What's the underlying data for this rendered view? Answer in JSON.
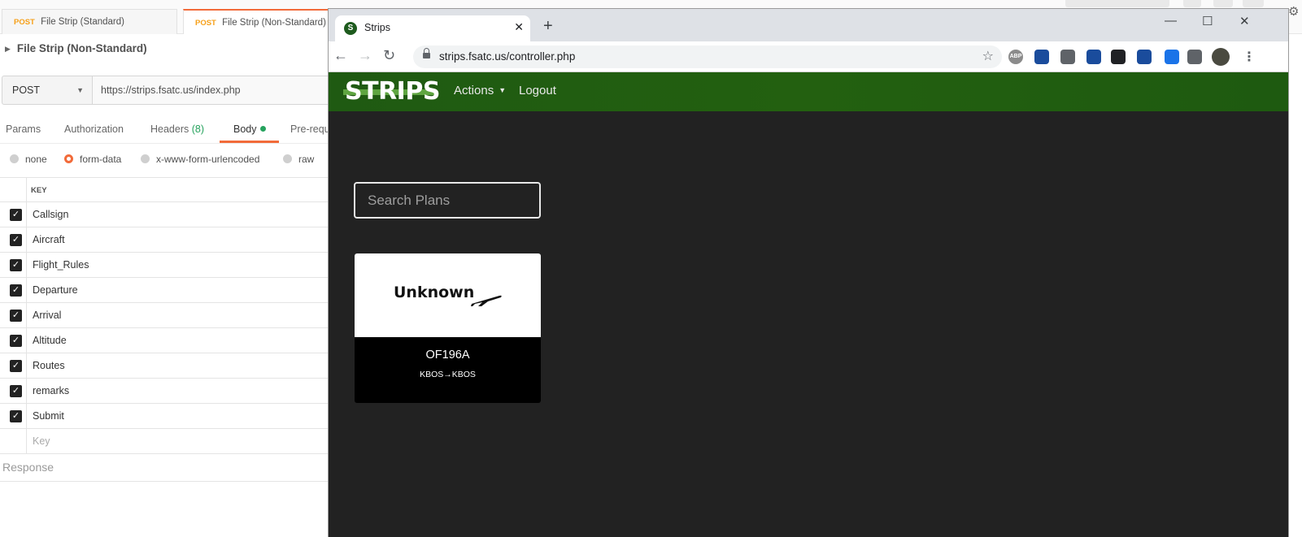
{
  "postman": {
    "tabs": [
      {
        "method": "POST",
        "label": "File Strip (Standard)"
      },
      {
        "method": "POST",
        "label": "File Strip (Non-Standard)"
      }
    ],
    "request_title": "File Strip (Non-Standard)",
    "method": "POST",
    "url": "https://strips.fsatc.us/index.php",
    "request_tabs": {
      "params": "Params",
      "authorization": "Authorization",
      "headers": "Headers",
      "headers_count": "(8)",
      "body": "Body",
      "prerequest": "Pre-requ"
    },
    "body_types": {
      "none": "none",
      "form_data": "form-data",
      "urlencoded": "x-www-form-urlencoded",
      "raw": "raw"
    },
    "table": {
      "key_header": "KEY",
      "rows": [
        "Callsign",
        "Aircraft",
        "Flight_Rules",
        "Departure",
        "Arrival",
        "Altitude",
        "Routes",
        "remarks",
        "Submit"
      ],
      "new_key_placeholder": "Key"
    },
    "response_label": "Response",
    "colors": {
      "accent": "#f26b3a",
      "method": "#f6a019",
      "count": "#26a25d"
    }
  },
  "browser": {
    "tab_title": "Strips",
    "favicon_letter": "S",
    "address": "strips.fsatc.us/controller.php",
    "extensions": [
      {
        "icon": "adblock-icon",
        "text": "ABP",
        "color": "#8b8b8b"
      },
      {
        "icon": "extension-blue-bars-icon",
        "text": "",
        "color": "#1a4c9c"
      },
      {
        "icon": "extension-audio-icon",
        "text": "",
        "color": "#5f6368"
      },
      {
        "icon": "extension-speaker-icon",
        "text": "",
        "color": "#1a4c9c"
      },
      {
        "icon": "extension-circle-icon",
        "text": "",
        "color": "#202124"
      },
      {
        "icon": "extension-image-icon",
        "text": "",
        "color": "#1a4c9c"
      },
      {
        "icon": "extension-eyedropper-icon",
        "text": "",
        "color": "#1a73e8"
      },
      {
        "icon": "extensions-puzzle-icon",
        "text": "",
        "color": "#5f6368"
      },
      {
        "icon": "profile-avatar-icon",
        "text": "",
        "color": "#4a4a40"
      }
    ]
  },
  "site": {
    "logo": "STRIPS",
    "nav": {
      "actions": "Actions",
      "logout": "Logout"
    },
    "search_placeholder": "Search Plans",
    "plans": [
      {
        "airline": "Unknown",
        "callsign": "OF196A",
        "route": "KBOS→KBOS"
      }
    ],
    "colors": {
      "navbar": "#236010",
      "background": "#222222"
    }
  }
}
